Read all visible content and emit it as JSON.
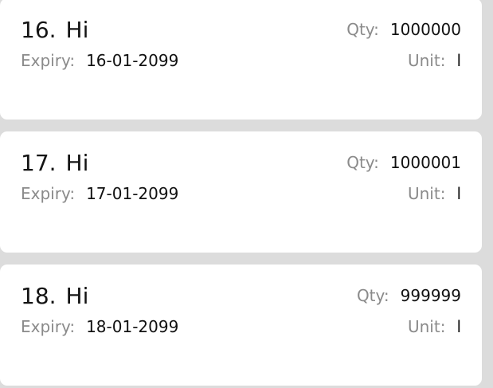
{
  "labels": {
    "qty": "Qty:",
    "expiry": "Expiry:",
    "unit": "Unit:"
  },
  "items": [
    {
      "index": "16.",
      "name": "Hi",
      "qty": "1000000",
      "expiry": "16-01-2099",
      "unit": "l"
    },
    {
      "index": "17.",
      "name": "Hi",
      "qty": "1000001",
      "expiry": "17-01-2099",
      "unit": "l"
    },
    {
      "index": "18.",
      "name": "Hi",
      "qty": "999999",
      "expiry": "18-01-2099",
      "unit": "l"
    }
  ]
}
